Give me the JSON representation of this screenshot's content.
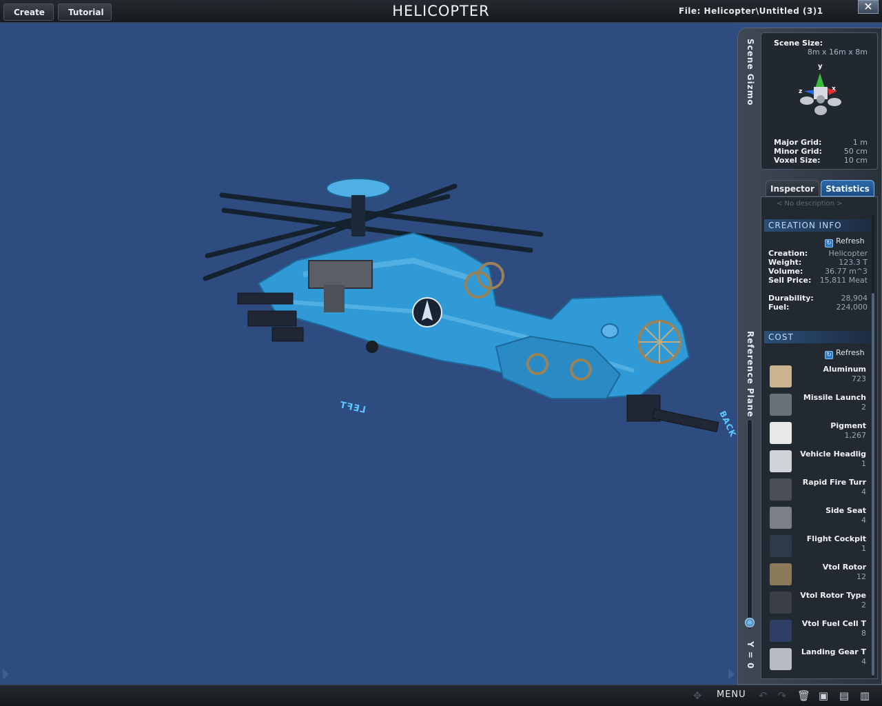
{
  "topbar": {
    "create_label": "Create",
    "tutorial_label": "Tutorial",
    "title": "HELICOPTER",
    "file_label": "File:  Helicopter\\Untitled (3)1",
    "close_icon": "close-icon"
  },
  "viewport": {
    "left_marker": "LEFT",
    "back_marker": "BACK"
  },
  "side_labels": {
    "scene_gizmo": "Scene Gizmo",
    "reference_plane": "Reference Plane",
    "y_value": "Y = 0"
  },
  "gizmo": {
    "scene_size_label": "Scene Size:",
    "scene_size_value": "8m x 16m x 8m",
    "axis_y": "y",
    "axis_z": "z",
    "axis_x": "x",
    "major_grid_label": "Major Grid:",
    "major_grid_value": "1 m",
    "minor_grid_label": "Minor Grid:",
    "minor_grid_value": "50 cm",
    "voxel_size_label": "Voxel Size:",
    "voxel_size_value": "10 cm"
  },
  "tabs": {
    "inspector": "Inspector",
    "statistics": "Statistics"
  },
  "stats": {
    "no_description": "< No description >",
    "creation_title": "CREATION INFO",
    "refresh_label": "Refresh",
    "creation_label": "Creation:",
    "creation_value": "Helicopter",
    "weight_label": "Weight:",
    "weight_value": "123.3 T",
    "volume_label": "Volume:",
    "volume_value": "36.77 m^3",
    "sell_price_label": "Sell Price:",
    "sell_price_value": "15,811 Meat",
    "durability_label": "Durability:",
    "durability_value": "28,904",
    "fuel_label": "Fuel:",
    "fuel_value": "224,000",
    "cost_title": "COST",
    "cost_items": [
      {
        "name": "Aluminum",
        "count": "723",
        "color": "#c9b48f"
      },
      {
        "name": "Missile Launch",
        "count": "2",
        "color": "#6a7078"
      },
      {
        "name": "Pigment",
        "count": "1,267",
        "color": "#e8e8e8"
      },
      {
        "name": "Vehicle Headlig",
        "count": "1",
        "color": "#cfd3d8"
      },
      {
        "name": "Rapid Fire Turr",
        "count": "4",
        "color": "#4a4f57"
      },
      {
        "name": "Side Seat",
        "count": "4",
        "color": "#7b7f86"
      },
      {
        "name": "Flight Cockpit",
        "count": "1",
        "color": "#2e3a4a"
      },
      {
        "name": "Vtol Rotor",
        "count": "12",
        "color": "#8a7a5a"
      },
      {
        "name": "Vtol Rotor Type",
        "count": "2",
        "color": "#3a3f45"
      },
      {
        "name": "Vtol Fuel Cell T",
        "count": "8",
        "color": "#2e3f66"
      },
      {
        "name": "Landing Gear T",
        "count": "4",
        "color": "#b8bcc2"
      }
    ]
  },
  "bottombar": {
    "menu_label": "MENU"
  },
  "colors": {
    "viewport_bg": "#2e4c7f",
    "helicopter_body": "#2f9ad6",
    "accent": "#2d6aa8"
  }
}
